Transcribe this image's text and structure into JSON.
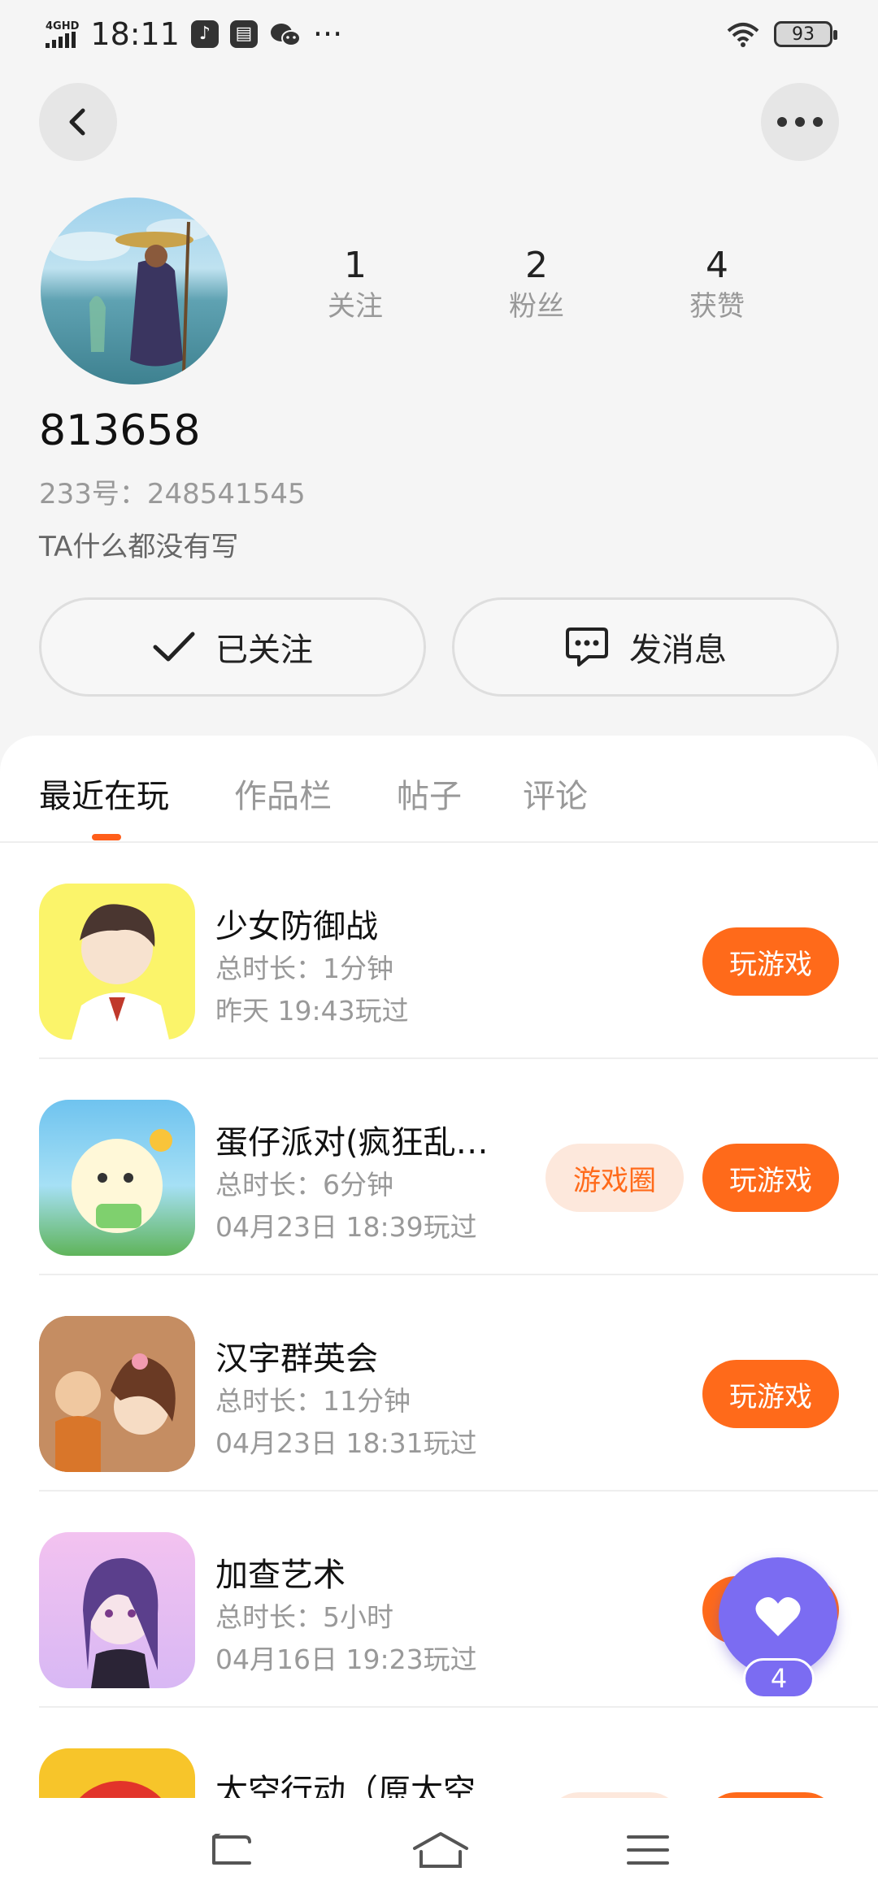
{
  "status_bar": {
    "network": "4GHD",
    "time": "18:11",
    "more": "···",
    "battery": "93"
  },
  "profile": {
    "username": "813658",
    "uid": "233号：248541545",
    "bio": "TA什么都没有写",
    "stats": [
      {
        "value": "1",
        "label": "关注"
      },
      {
        "value": "2",
        "label": "粉丝"
      },
      {
        "value": "4",
        "label": "获赞"
      }
    ],
    "follow_label": "已关注",
    "message_label": "发消息"
  },
  "tabs": [
    {
      "label": "最近在玩",
      "active": true
    },
    {
      "label": "作品栏",
      "active": false
    },
    {
      "label": "帖子",
      "active": false
    },
    {
      "label": "评论",
      "active": false
    }
  ],
  "games": [
    {
      "title": "少女防御战",
      "duration": "总时长：1分钟",
      "last_played": "昨天 19:43玩过",
      "play_label": "玩游戏",
      "circle_label": ""
    },
    {
      "title": "蛋仔派对(疯狂乱…",
      "duration": "总时长：6分钟",
      "last_played": "04月23日 18:39玩过",
      "play_label": "玩游戏",
      "circle_label": "游戏圈"
    },
    {
      "title": "汉字群英会",
      "duration": "总时长：11分钟",
      "last_played": "04月23日 18:31玩过",
      "play_label": "玩游戏",
      "circle_label": ""
    },
    {
      "title": "加查艺术",
      "duration": "总时长：5小时",
      "last_played": "04月16日 19:23玩过",
      "play_label": "玩游戏",
      "circle_label": ""
    },
    {
      "title": "太空行动（原太空…",
      "duration": "",
      "last_played": "",
      "play_label": "",
      "circle_label": ""
    }
  ],
  "fab": {
    "count": "4",
    "icon": "heart-icon"
  },
  "colors": {
    "accent": "#ff6a1a",
    "fab": "#7b6cf2",
    "circle_bg": "#fde8dc"
  }
}
